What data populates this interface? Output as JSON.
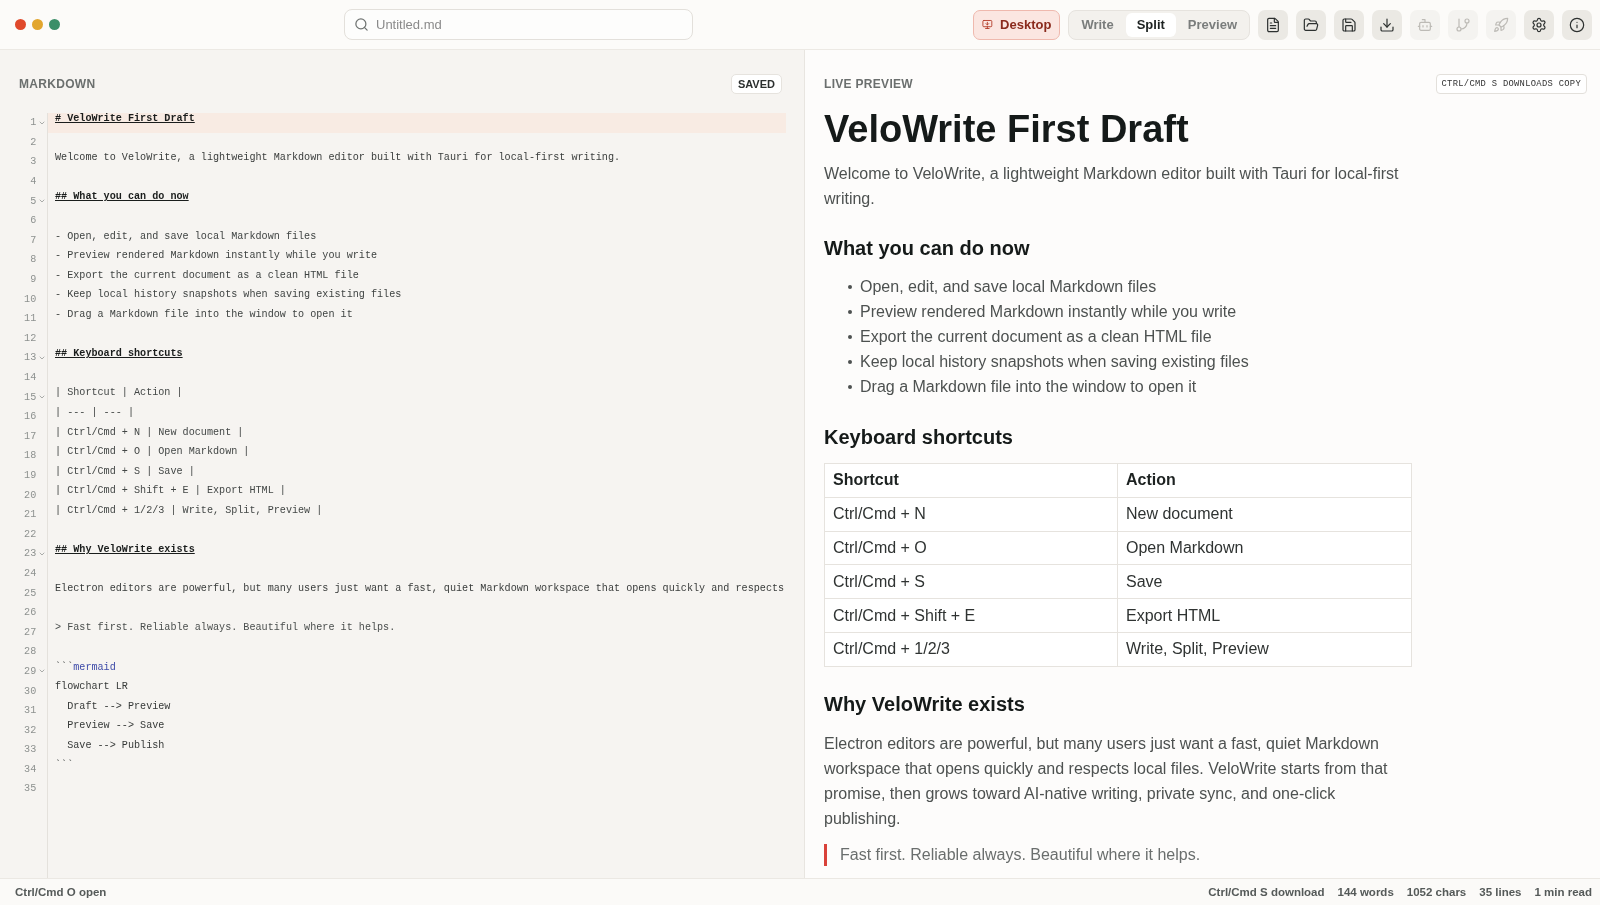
{
  "window": {
    "controls": [
      {
        "color": "#e0492b"
      },
      {
        "color": "#e2a62e"
      },
      {
        "color": "#3b8f68"
      }
    ]
  },
  "toolbar": {
    "search": {
      "placeholder": "Untitled.md"
    },
    "desktop_button": {
      "label": "Desktop"
    },
    "view_modes": [
      {
        "label": "Write",
        "selected": false
      },
      {
        "label": "Split",
        "selected": true
      },
      {
        "label": "Preview",
        "selected": false
      }
    ],
    "tool_buttons": [
      {
        "disabled": false
      },
      {
        "disabled": false
      },
      {
        "disabled": false
      },
      {
        "disabled": false
      },
      {
        "disabled": true
      },
      {
        "disabled": true
      },
      {
        "disabled": true
      },
      {
        "disabled": false
      },
      {
        "disabled": false
      }
    ]
  },
  "editor": {
    "title": "MARKDOWN",
    "status": "SAVED",
    "lines": [
      {
        "number": "1",
        "kind": "heading",
        "text": "# VeloWrite First Draft",
        "foldable": true,
        "active": true
      },
      {
        "number": "2",
        "kind": "blank",
        "foldable": false,
        "active": false
      },
      {
        "number": "3",
        "kind": "text",
        "text": "Welcome to VeloWrite, a lightweight Markdown editor built with Tauri for local-first writing.",
        "foldable": false,
        "active": false
      },
      {
        "number": "4",
        "kind": "blank",
        "foldable": false,
        "active": false
      },
      {
        "number": "5",
        "kind": "heading",
        "text": "## What you can do now",
        "foldable": true,
        "active": false
      },
      {
        "number": "6",
        "kind": "blank",
        "foldable": false,
        "active": false
      },
      {
        "number": "7",
        "kind": "list",
        "text": "- Open, edit, and save local Markdown files",
        "foldable": false,
        "active": false
      },
      {
        "number": "8",
        "kind": "list",
        "text": "- Preview rendered Markdown instantly while you write",
        "foldable": false,
        "active": false
      },
      {
        "number": "9",
        "kind": "list",
        "text": "- Export the current document as a clean HTML file",
        "foldable": false,
        "active": false
      },
      {
        "number": "10",
        "kind": "list",
        "text": "- Keep local history snapshots when saving existing files",
        "foldable": false,
        "active": false
      },
      {
        "number": "11",
        "kind": "list",
        "text": "- Drag a Markdown file into the window to open it",
        "foldable": false,
        "active": false
      },
      {
        "number": "12",
        "kind": "blank",
        "foldable": false,
        "active": false
      },
      {
        "number": "13",
        "kind": "heading",
        "text": "## Keyboard shortcuts",
        "foldable": true,
        "active": false
      },
      {
        "number": "14",
        "kind": "blank",
        "foldable": false,
        "active": false
      },
      {
        "number": "15",
        "kind": "table",
        "text": "| Shortcut | Action |",
        "foldable": true,
        "active": false
      },
      {
        "number": "16",
        "kind": "table",
        "text": "| --- | --- |",
        "foldable": false,
        "active": false
      },
      {
        "number": "17",
        "kind": "table",
        "text": "| Ctrl/Cmd + N | New document |",
        "foldable": false,
        "active": false
      },
      {
        "number": "18",
        "kind": "table",
        "text": "| Ctrl/Cmd + O | Open Markdown |",
        "foldable": false,
        "active": false
      },
      {
        "number": "19",
        "kind": "table",
        "text": "| Ctrl/Cmd + S | Save |",
        "foldable": false,
        "active": false
      },
      {
        "number": "20",
        "kind": "table",
        "text": "| Ctrl/Cmd + Shift + E | Export HTML |",
        "foldable": false,
        "active": false
      },
      {
        "number": "21",
        "kind": "table",
        "text": "| Ctrl/Cmd + 1/2/3 | Write, Split, Preview |",
        "foldable": false,
        "active": false
      },
      {
        "number": "22",
        "kind": "blank",
        "foldable": false,
        "active": false
      },
      {
        "number": "23",
        "kind": "heading",
        "text": "## Why VeloWrite exists",
        "foldable": true,
        "active": false
      },
      {
        "number": "24",
        "kind": "blank",
        "foldable": false,
        "active": false
      },
      {
        "number": "25",
        "kind": "text",
        "text": "Electron editors are powerful, but many users just want a fast, quiet Markdown workspace that opens quickly and respects",
        "foldable": false,
        "active": false
      },
      {
        "number": "26",
        "kind": "blank",
        "foldable": false,
        "active": false
      },
      {
        "number": "27",
        "kind": "quote",
        "text": "> Fast first. Reliable always. Beautiful where it helps.",
        "foldable": false,
        "active": false
      },
      {
        "number": "28",
        "kind": "blank",
        "foldable": false,
        "active": false
      },
      {
        "number": "29",
        "kind": "fence",
        "text": "```",
        "lang": "mermaid",
        "foldable": true,
        "active": false
      },
      {
        "number": "30",
        "kind": "code",
        "text": "flowchart LR",
        "foldable": false,
        "active": false
      },
      {
        "number": "31",
        "kind": "code",
        "text": "  Draft --> Preview",
        "foldable": false,
        "active": false
      },
      {
        "number": "32",
        "kind": "code",
        "text": "  Preview --> Save",
        "foldable": false,
        "active": false
      },
      {
        "number": "33",
        "kind": "code",
        "text": "  Save --> Publish",
        "foldable": false,
        "active": false
      },
      {
        "number": "34",
        "kind": "fence",
        "text": "```",
        "foldable": false,
        "active": false
      },
      {
        "number": "35",
        "kind": "blank",
        "foldable": false,
        "active": false
      }
    ]
  },
  "preview": {
    "title": "LIVE PREVIEW",
    "badge": "CTRL/CMD S DOWNLOADS COPY",
    "blocks": [
      {
        "kind": "h1",
        "text": "VeloWrite First Draft"
      },
      {
        "kind": "paragraph",
        "text": "Welcome to VeloWrite, a lightweight Markdown editor built with Tauri for local-first writing."
      },
      {
        "kind": "h2",
        "text": "What you can do now"
      },
      {
        "kind": "list",
        "items": [
          "Open, edit, and save local Markdown files",
          "Preview rendered Markdown instantly while you write",
          "Export the current document as a clean HTML file",
          "Keep local history snapshots when saving existing files",
          "Drag a Markdown file into the window to open it"
        ]
      },
      {
        "kind": "h2",
        "text": "Keyboard shortcuts"
      },
      {
        "kind": "table",
        "columns": [
          "Shortcut",
          "Action"
        ],
        "rows": [
          [
            "Ctrl/Cmd + N",
            "New document"
          ],
          [
            "Ctrl/Cmd + O",
            "Open Markdown"
          ],
          [
            "Ctrl/Cmd + S",
            "Save"
          ],
          [
            "Ctrl/Cmd + Shift + E",
            "Export HTML"
          ],
          [
            "Ctrl/Cmd + 1/2/3",
            "Write, Split, Preview"
          ]
        ]
      },
      {
        "kind": "h2",
        "text": "Why VeloWrite exists"
      },
      {
        "kind": "paragraph",
        "text": "Electron editors are powerful, but many users just want a fast, quiet Markdown workspace that opens quickly and respects local files. VeloWrite starts from that promise, then grows toward AI-native writing, private sync, and one-click publishing."
      },
      {
        "kind": "blockquote",
        "text": "Fast first. Reliable always. Beautiful where it helps."
      }
    ]
  },
  "status_bar": {
    "left": "Ctrl/Cmd O open",
    "right": [
      "Ctrl/Cmd S download",
      "144 words",
      "1052 chars",
      "35 lines",
      "1 min read"
    ]
  }
}
